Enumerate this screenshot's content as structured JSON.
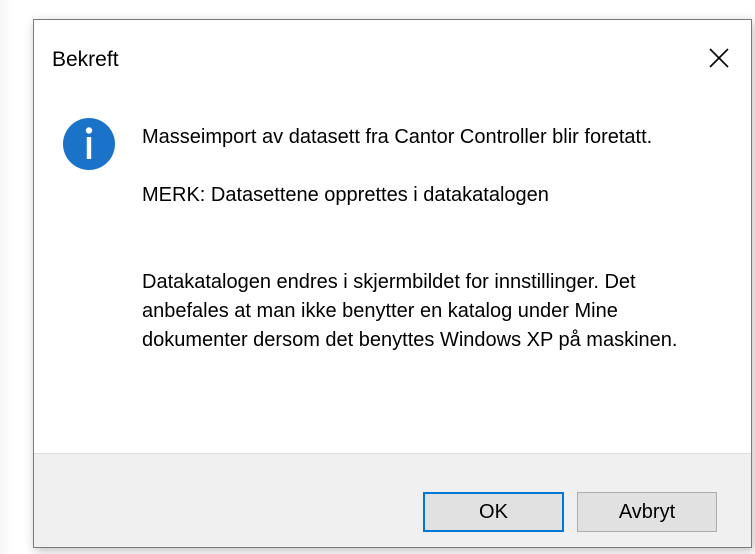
{
  "dialog": {
    "title": "Bekreft",
    "close_icon": "close-icon",
    "message_icon": "information-icon",
    "message": {
      "line1": "Masseimport av datasett fra Cantor Controller blir foretatt.",
      "merk": "MERK: Datasettene opprettes i datakatalogen",
      "detail": "Datakatalogen endres i skjermbildet for innstillinger. Det anbefales at man ikke benytter en katalog under Mine dokumenter dersom det benyttes Windows XP på maskinen."
    },
    "buttons": {
      "ok_label": "OK",
      "cancel_label": "Avbryt"
    }
  },
  "colors": {
    "info_icon": "#1a73c8",
    "default_button_border": "#0078d7",
    "footer_background": "#f0f0f0"
  }
}
